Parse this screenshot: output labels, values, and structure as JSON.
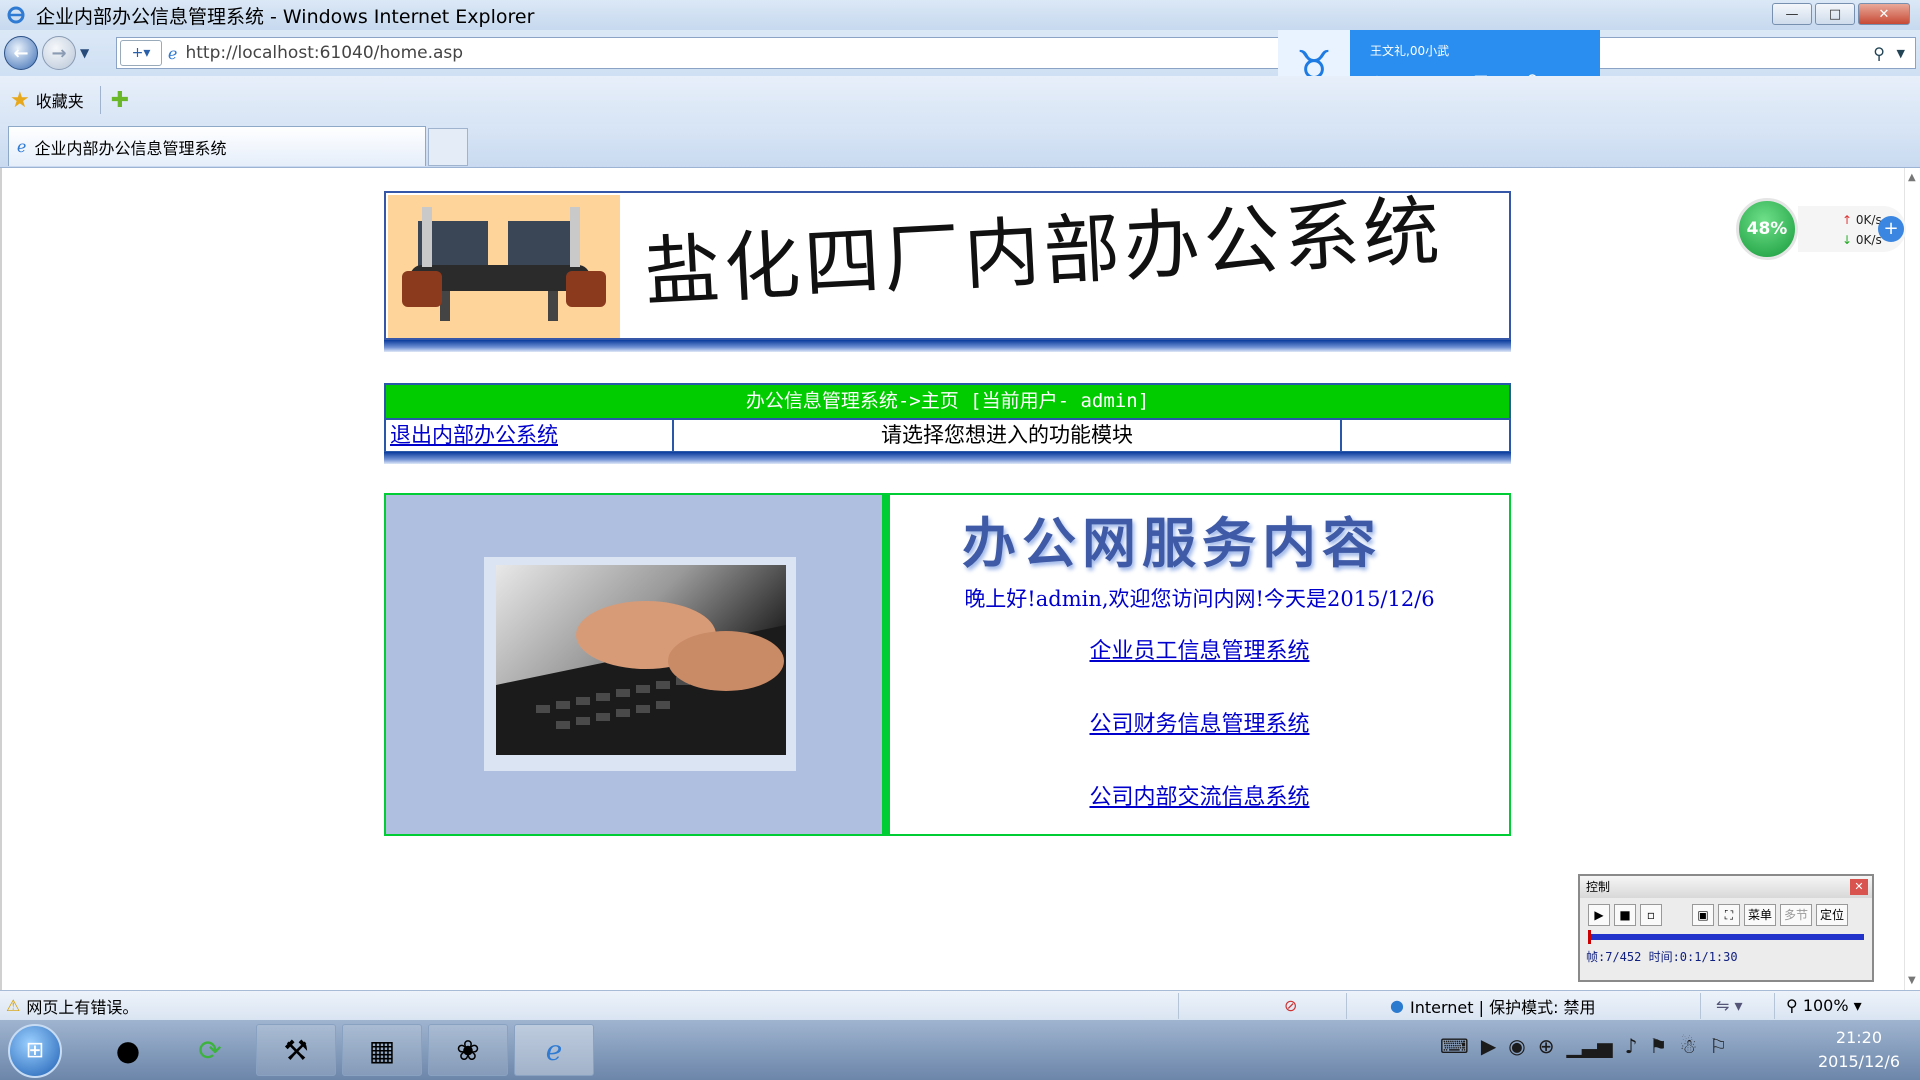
{
  "window": {
    "title": "企业内部办公信息管理系统 - Windows Internet Explorer",
    "controls": {
      "minimize": "—",
      "maximize": "□",
      "close": "✕"
    }
  },
  "address_bar": {
    "url": "http://localhost:61040/home.asp"
  },
  "favorites_bar": {
    "favorites_label": "收藏夹"
  },
  "tab": {
    "label": "企业内部办公信息管理系统"
  },
  "qq_widget": {
    "name": "王文礼,00小武"
  },
  "net_monitor": {
    "percent": "48%",
    "up_speed": "0K/s",
    "down_speed": "0K/s"
  },
  "page": {
    "banner_title": "盐化四厂内部办公系统",
    "nav_header": "办公信息管理系统->主页 [当前用户- admin]",
    "logout_link": "退出内部办公系统",
    "module_prompt": "请选择您想进入的功能模块",
    "service_title": "办公网服务内容",
    "greeting": "晚上好!admin,欢迎您访问内网!今天是2015/12/6",
    "links": [
      "企业员工信息管理系统",
      "公司财务信息管理系统",
      "公司内部交流信息系统"
    ]
  },
  "control_panel": {
    "title": "控制",
    "menu_label": "菜单",
    "chapter_label": "多节",
    "locate_label": "定位",
    "status": "帧:7/452 时间:0:1/1:30"
  },
  "status_bar": {
    "error_text": "网页上有错误。",
    "zone": "Internet | 保护模式: 禁用",
    "zoom": "100%"
  },
  "taskbar": {
    "time": "21:20",
    "date": "2015/12/6"
  },
  "colors": {
    "accent_green": "#00cc00",
    "link_blue": "#0000cc",
    "frame_blue": "#2958a8"
  }
}
